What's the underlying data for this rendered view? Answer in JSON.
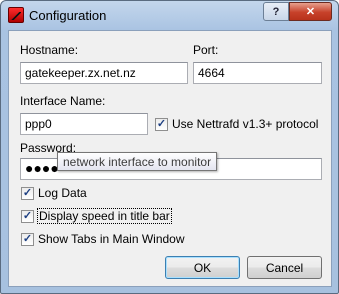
{
  "window": {
    "title": "Configuration",
    "help_glyph": "?",
    "close_glyph": "✕"
  },
  "icons": {
    "app": "nettrafd-app-icon",
    "help": "help-icon",
    "close": "close-icon",
    "check": "checkmark-icon"
  },
  "form": {
    "hostname_label": "Hostname:",
    "hostname_value": "gatekeeper.zx.net.nz",
    "port_label": "Port:",
    "port_value": "4664",
    "interface_label": "Interface Name:",
    "interface_value": "ppp0",
    "nettrafd_label": "Use Nettrafd v1.3+ protocol",
    "password_label": "Password:",
    "password_value": "●●●●",
    "tooltip": "network interface to monitor"
  },
  "options": {
    "log_data": "Log Data",
    "title_speed": "Display speed in title bar",
    "show_tabs": "Show Tabs in Main Window"
  },
  "checked": {
    "nettrafd": true,
    "log_data": true,
    "title_speed": true,
    "show_tabs": true
  },
  "buttons": {
    "ok": "OK",
    "cancel": "Cancel"
  }
}
